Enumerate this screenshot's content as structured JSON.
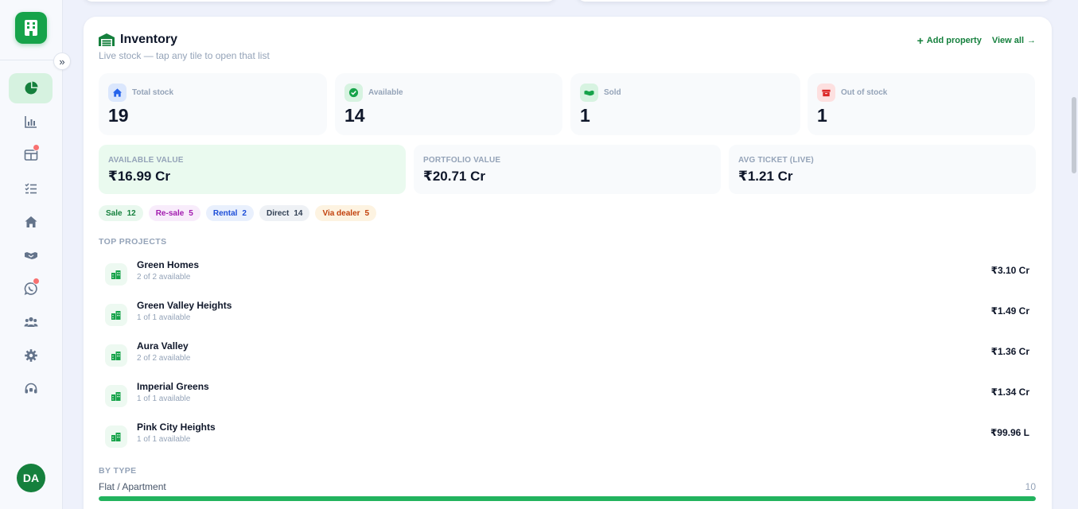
{
  "sidebar": {
    "avatar_initials": "DA",
    "nav": [
      {
        "icon": "pie-chart-icon",
        "active": true
      },
      {
        "icon": "bar-chart-icon"
      },
      {
        "icon": "layout-icon",
        "badge": true
      },
      {
        "icon": "checklist-icon"
      },
      {
        "icon": "home-icon"
      },
      {
        "icon": "handshake-icon"
      },
      {
        "icon": "whatsapp-icon",
        "badge": true
      },
      {
        "icon": "team-icon"
      },
      {
        "icon": "gear-icon"
      },
      {
        "icon": "headset-icon"
      }
    ]
  },
  "inventory": {
    "title": "Inventory",
    "subtitle": "Live stock — tap any tile to open that list",
    "add_property": "Add property",
    "view_all": "View all",
    "stats": [
      {
        "label": "Total stock",
        "value": "19",
        "icon": "home-icon",
        "color": "#2563eb"
      },
      {
        "label": "Available",
        "value": "14",
        "icon": "check-circle-icon",
        "color": "#16a34a"
      },
      {
        "label": "Sold",
        "value": "1",
        "icon": "handshake-icon",
        "color": "#16a34a"
      },
      {
        "label": "Out of stock",
        "value": "1",
        "icon": "box-icon",
        "color": "#dc2626"
      }
    ],
    "values": [
      {
        "label": "AVAILABLE VALUE",
        "amount": "₹16.99 Cr"
      },
      {
        "label": "PORTFOLIO VALUE",
        "amount": "₹20.71 Cr"
      },
      {
        "label": "AVG TICKET (LIVE)",
        "amount": "₹1.21 Cr"
      }
    ],
    "chips": [
      {
        "label": "Sale",
        "count": "12",
        "fg": "#15803d",
        "bg": "#e9f8ee"
      },
      {
        "label": "Re-sale",
        "count": "5",
        "fg": "#a21caf",
        "bg": "#f8ecfb"
      },
      {
        "label": "Rental",
        "count": "2",
        "fg": "#1d4ed8",
        "bg": "#e9f0fd"
      },
      {
        "label": "Direct",
        "count": "14",
        "fg": "#334155",
        "bg": "#eef1f5"
      },
      {
        "label": "Via dealer",
        "count": "5",
        "fg": "#c2410c",
        "bg": "#fdf3e1"
      }
    ],
    "top_projects_label": "TOP PROJECTS",
    "projects": [
      {
        "name": "Green Homes",
        "sub": "2 of 2 available",
        "amount": "₹3.10 Cr"
      },
      {
        "name": "Green Valley Heights",
        "sub": "1 of 1 available",
        "amount": "₹1.49 Cr"
      },
      {
        "name": "Aura Valley",
        "sub": "2 of 2 available",
        "amount": "₹1.36 Cr"
      },
      {
        "name": "Imperial Greens",
        "sub": "1 of 1 available",
        "amount": "₹1.34 Cr"
      },
      {
        "name": "Pink City Heights",
        "sub": "1 of 1 available",
        "amount": "₹99.96 L"
      }
    ],
    "by_type_label": "BY TYPE",
    "by_type": [
      {
        "label": "Flat / Apartment",
        "count": "10",
        "fraction": 1.0
      }
    ]
  }
}
